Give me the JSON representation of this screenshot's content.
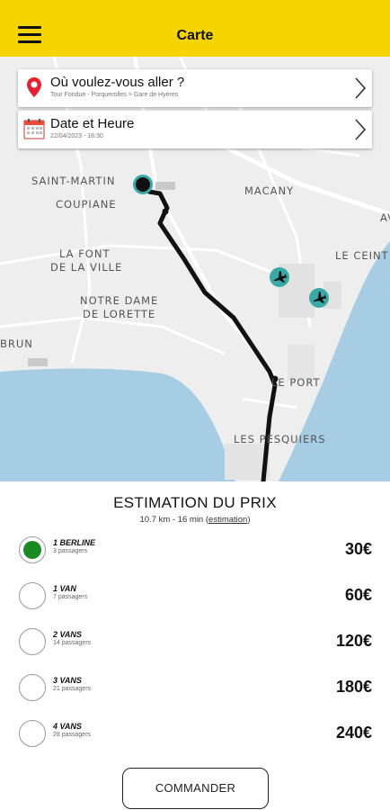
{
  "header": {
    "title": "Carte",
    "menu_icon": "hamburger-menu-icon"
  },
  "colors": {
    "brand": "#f6d400",
    "selected": "#1a8a23",
    "airport": "#3aa9a6",
    "water": "#a6cde3",
    "route": "#111111"
  },
  "search": {
    "destination": {
      "title": "Où voulez-vous aller ?",
      "subtitle": "Tour Fondue - Porquerolles > Gare de Hyères",
      "icon": "location-pin-icon"
    },
    "datetime": {
      "title": "Date et Heure",
      "subtitle": "22/04/2023 - 18:30",
      "icon": "calendar-icon"
    }
  },
  "map": {
    "places": [
      "SAINT-MARTIN",
      "COUPIANE",
      "MACANY",
      "LA FONT",
      "DE LA VILLE",
      "NOTRE DAME",
      "DE LORETTE",
      "BRUN",
      "LE PORT",
      "LES PESQUIERS",
      "LE CEINT",
      "AV"
    ]
  },
  "estimate": {
    "title": "ESTIMATION DU PRIX",
    "summary": "10.7 km - 16 min (",
    "link": "estimation",
    "summary_end": ")",
    "options": [
      {
        "name": "1 BERLINE",
        "capacity": "3 passagers",
        "price": "30€",
        "selected": true
      },
      {
        "name": "1 VAN",
        "capacity": "7 passagers",
        "price": "60€",
        "selected": false
      },
      {
        "name": "2 VANS",
        "capacity": "14 passagers",
        "price": "120€",
        "selected": false
      },
      {
        "name": "3 VANS",
        "capacity": "21 passagers",
        "price": "180€",
        "selected": false
      },
      {
        "name": "4 VANS",
        "capacity": "28 passagers",
        "price": "240€",
        "selected": false
      }
    ]
  },
  "order_button": "COMMANDER"
}
